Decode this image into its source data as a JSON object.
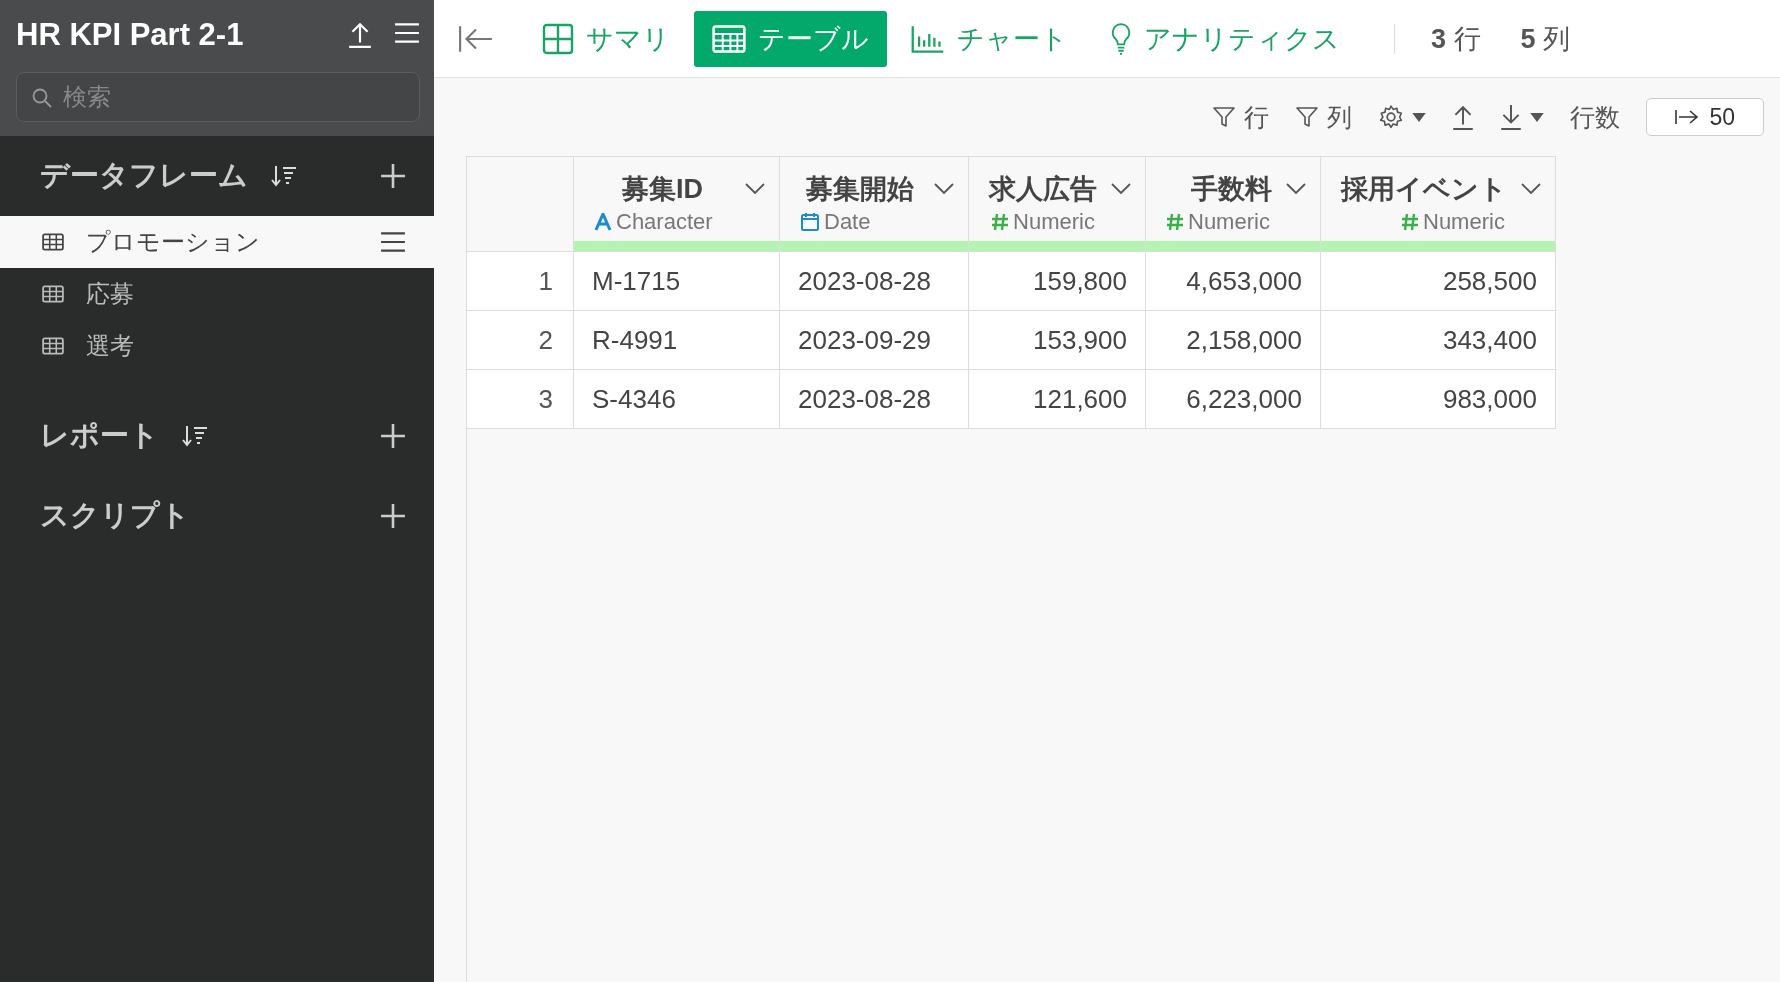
{
  "sidebar": {
    "title": "HR KPI Part 2-1",
    "search": {
      "placeholder": "検索"
    },
    "sections": [
      {
        "title": "データフレーム",
        "sortable": true,
        "items": [
          {
            "label": "プロモーション",
            "selected": true
          },
          {
            "label": "応募",
            "selected": false
          },
          {
            "label": "選考",
            "selected": false
          }
        ]
      },
      {
        "title": "レポート",
        "sortable": true
      },
      {
        "title": "スクリプト",
        "sortable": false
      }
    ]
  },
  "view_tabs": [
    {
      "kind": "summary",
      "label": "サマリ",
      "selected": false
    },
    {
      "kind": "table",
      "label": "テーブル",
      "selected": true
    },
    {
      "kind": "chart",
      "label": "チャート",
      "selected": false
    },
    {
      "kind": "analytics",
      "label": "アナリティクス",
      "selected": false
    }
  ],
  "counts": [
    {
      "number": "3",
      "unit": "行"
    },
    {
      "number": "5",
      "unit": "列"
    }
  ],
  "toolbar": {
    "row_filter": "行",
    "column_filter": "列",
    "row_limit_label": "行数",
    "row_limit": "50"
  },
  "table": {
    "columns": [
      {
        "name": "募集ID",
        "kind": "character",
        "type_label": "Character"
      },
      {
        "name": "募集開始",
        "kind": "date",
        "type_label": "Date"
      },
      {
        "name": "求人広告",
        "kind": "numeric",
        "type_label": "Numeric"
      },
      {
        "name": "手数料",
        "kind": "numeric",
        "type_label": "Numeric"
      },
      {
        "name": "採用イベント",
        "kind": "numeric",
        "type_label": "Numeric"
      }
    ],
    "rows": [
      {
        "index": "1",
        "cells": [
          "M-1715",
          "2023-08-28",
          "159,800",
          "4,653,000",
          "258,500"
        ]
      },
      {
        "index": "2",
        "cells": [
          "R-4991",
          "2023-09-29",
          "153,900",
          "2,158,000",
          "343,400"
        ]
      },
      {
        "index": "3",
        "cells": [
          "S-4346",
          "2023-08-28",
          "121,600",
          "6,223,000",
          "983,000"
        ]
      }
    ]
  }
}
